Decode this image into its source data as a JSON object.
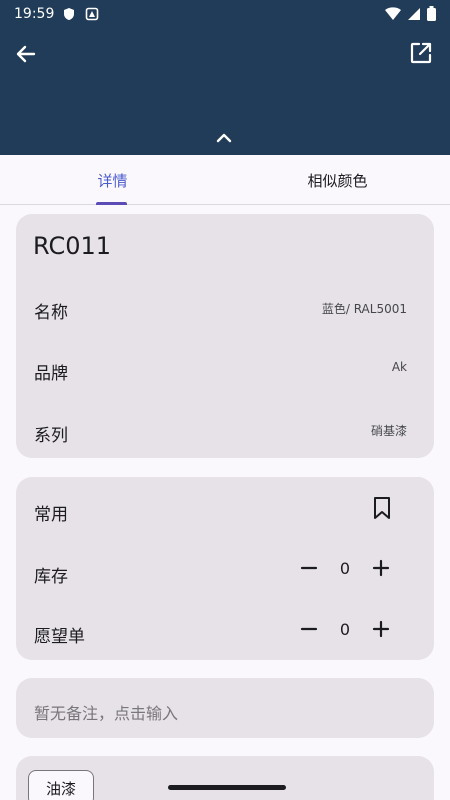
{
  "status_bar": {
    "time": "19:59"
  },
  "tabs": [
    {
      "label": "详情"
    },
    {
      "label": "相似颜色"
    }
  ],
  "color": {
    "code": "RC011",
    "rows": [
      {
        "label": "名称",
        "value": "蓝色/ RAL5001"
      },
      {
        "label": "品牌",
        "value": "Ak"
      },
      {
        "label": "系列",
        "value": "硝基漆"
      }
    ]
  },
  "actions": {
    "favorite_label": "常用",
    "stock_label": "库存",
    "stock_value": "0",
    "wishlist_label": "愿望单",
    "wishlist_value": "0"
  },
  "note": {
    "placeholder": "暂无备注，点击输入"
  },
  "category_chip": {
    "label": "油漆"
  },
  "colors": {
    "header_bg": "#213c58",
    "accent": "#5b4bb5",
    "card_bg": "#e6e2e8"
  }
}
